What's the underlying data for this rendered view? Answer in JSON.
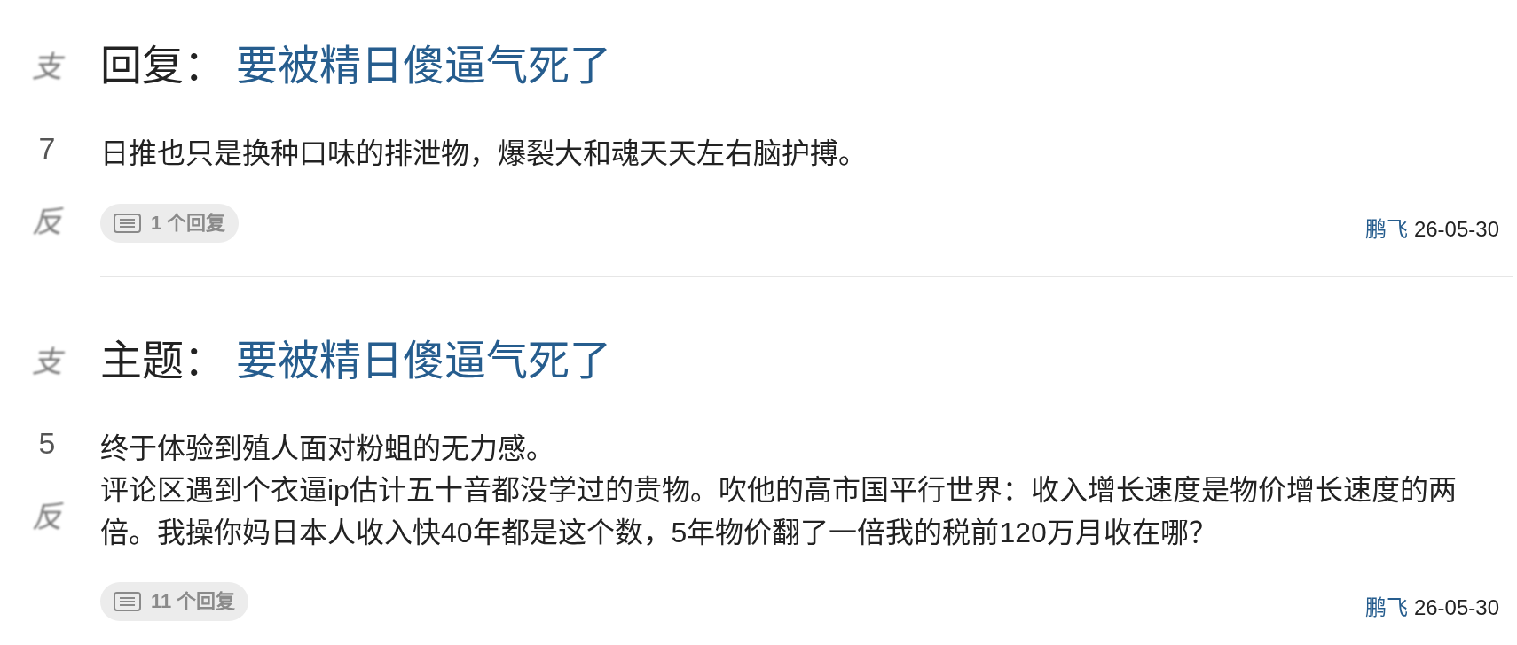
{
  "posts": [
    {
      "votes": {
        "up": "支",
        "score": "7",
        "down": "反"
      },
      "prefix": "回复：",
      "title": "要被精日傻逼气死了",
      "body": [
        "日推也只是换种口味的排泄物，爆裂大和魂天天左右脑护搏。"
      ],
      "replies": "1 个回复",
      "author": "鹏飞",
      "date": "26-05-30"
    },
    {
      "votes": {
        "up": "支",
        "score": "5",
        "down": "反"
      },
      "prefix": "主题：",
      "title": "要被精日傻逼气死了",
      "body": [
        "终于体验到殖人面对粉蛆的无力感。",
        "评论区遇到个衣逼ip估计五十音都没学过的贵物。吹他的高市国平行世界：收入增长速度是物价增长速度的两倍。我操你妈日本人收入快40年都是这个数，5年物价翻了一倍我的税前120万月收在哪？"
      ],
      "replies": "11 个回复",
      "author": "鹏飞",
      "date": "26-05-30"
    }
  ]
}
